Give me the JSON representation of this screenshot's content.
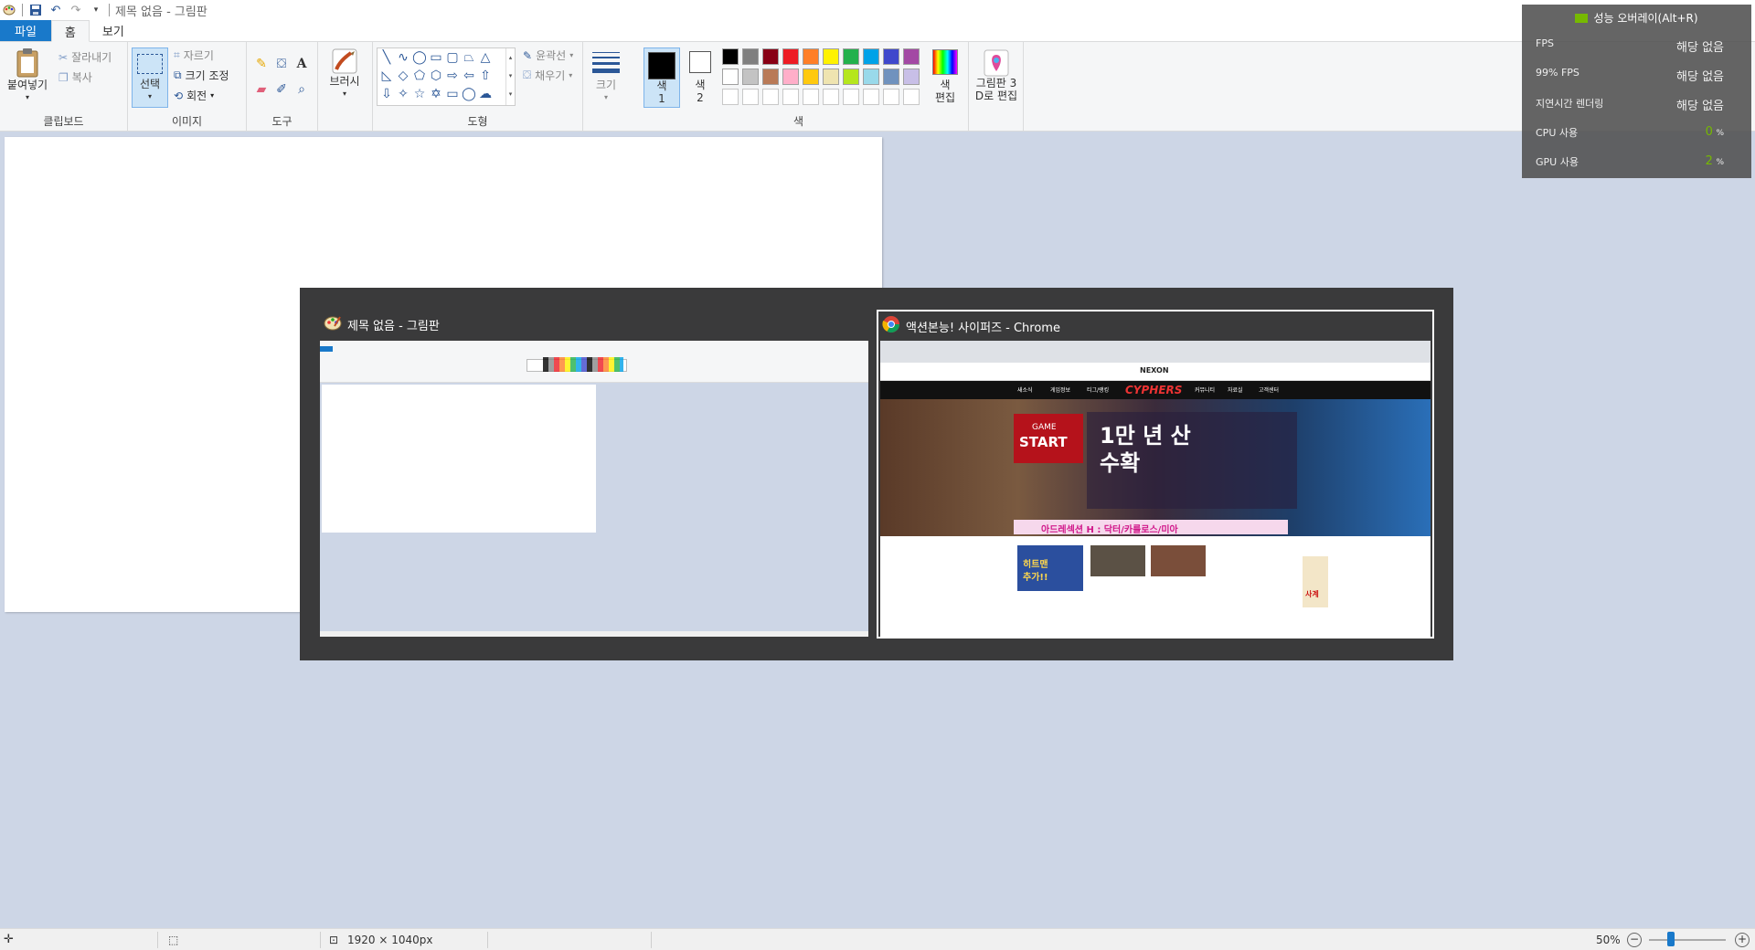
{
  "window": {
    "title": "제목 없음 - 그림판"
  },
  "tabs": {
    "file": "파일",
    "home": "홈",
    "view": "보기"
  },
  "clipboard": {
    "paste": "붙여넣기",
    "cut": "잘라내기",
    "copy": "복사",
    "label": "클립보드"
  },
  "image": {
    "select": "선택",
    "crop": "자르기",
    "resize": "크기 조정",
    "rotate": "회전",
    "label": "이미지"
  },
  "tools": {
    "label": "도구"
  },
  "brushes": {
    "label": "브러시"
  },
  "shapes": {
    "outline": "윤곽선",
    "fill": "채우기",
    "label": "도형"
  },
  "size": {
    "label": "크기"
  },
  "colors": {
    "color1": "색\n1",
    "color1_a": "색",
    "color1_b": "1",
    "color2_a": "색",
    "color2_b": "2",
    "edit_a": "색",
    "edit_b": "편집",
    "label": "색",
    "row1": [
      "#000000",
      "#7f7f7f",
      "#880015",
      "#ed1c24",
      "#ff7f27",
      "#fff200",
      "#22b14c",
      "#00a2e8",
      "#3f48cc",
      "#a349a4"
    ],
    "row2": [
      "#ffffff",
      "#c3c3c3",
      "#b97a57",
      "#ffaec9",
      "#ffc90e",
      "#efe4b0",
      "#b5e61d",
      "#99d9ea",
      "#7092be",
      "#c8bfe7"
    ],
    "row3": [
      "#ffffff",
      "#ffffff",
      "#ffffff",
      "#ffffff",
      "#ffffff",
      "#ffffff",
      "#ffffff",
      "#ffffff",
      "#ffffff",
      "#ffffff"
    ]
  },
  "paint3d": {
    "line1": "그림판 3",
    "line2": "D로 편집"
  },
  "status": {
    "dimensions": "1920 × 1040px",
    "zoom": "50%"
  },
  "switcher": {
    "win1": {
      "title": "제목 없음 - 그림판"
    },
    "win2": {
      "title": "액션본능! 사이퍼즈 - Chrome",
      "brand": "NEXON",
      "game_logo": "CYPHERS",
      "game": "GAME",
      "start": "START",
      "banner_title": "1만 년 산\n수확",
      "banner_title_a": "1만 년 산",
      "banner_title_b": "수확",
      "promo": "아드레섹션 H : 닥터/카를로스/미아",
      "nav": [
        "새소식",
        "게임정보",
        "티그/랭킹",
        "커뮤니티",
        "자료실",
        "고객센터"
      ],
      "news_headline": "히트맨\n추가!!",
      "news_a": "히트맨",
      "news_b": "추가!!",
      "side_badge": "사계"
    }
  },
  "overlay": {
    "title": "성능 오버레이(Alt+R)",
    "rows": [
      {
        "label": "FPS",
        "value": "해당 없음"
      },
      {
        "label": "99% FPS",
        "value": "해당 없음"
      },
      {
        "label": "지연시간 렌더링",
        "value": "해당 없음"
      }
    ],
    "cpu_label": "CPU 사용",
    "cpu_value": "0",
    "gpu_label": "GPU 사용",
    "gpu_value": "2",
    "unit": "%"
  }
}
